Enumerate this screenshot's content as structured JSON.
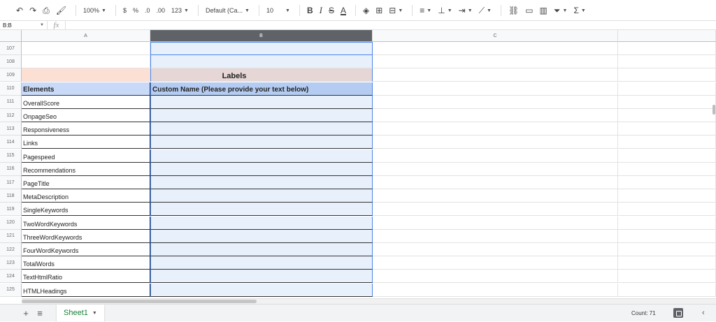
{
  "toolbar": {
    "zoom": "100%",
    "currency": "$",
    "percent": "%",
    "decrease_decimal": ".0",
    "increase_decimal": ".00",
    "more_formats": "123",
    "font_family": "Default (Ca...",
    "font_size": "10",
    "bold": "B",
    "italic": "I",
    "strike": "S",
    "text_color": "A",
    "sum": "Σ"
  },
  "formula_bar": {
    "name_box": "B:B",
    "fx": "fx",
    "content": ""
  },
  "columns": [
    "A",
    "B",
    "C"
  ],
  "selected_column": "B",
  "rows": [
    {
      "num": "107",
      "a": "",
      "b": ""
    },
    {
      "num": "108",
      "a": "",
      "b": ""
    },
    {
      "num": "109",
      "a": "",
      "b": "Labels"
    },
    {
      "num": "110",
      "a": "Elements",
      "b": "Custom Name (Please provide your text below)"
    },
    {
      "num": "111",
      "a": "OverallScore",
      "b": ""
    },
    {
      "num": "112",
      "a": "OnpageSeo",
      "b": ""
    },
    {
      "num": "113",
      "a": "Responsiveness",
      "b": ""
    },
    {
      "num": "114",
      "a": "Links",
      "b": ""
    },
    {
      "num": "115",
      "a": "Pagespeed",
      "b": ""
    },
    {
      "num": "116",
      "a": "Recommendations",
      "b": ""
    },
    {
      "num": "117",
      "a": "PageTitle",
      "b": ""
    },
    {
      "num": "118",
      "a": "MetaDescription",
      "b": ""
    },
    {
      "num": "119",
      "a": "SingleKeywords",
      "b": ""
    },
    {
      "num": "120",
      "a": "TwoWordKeywords",
      "b": ""
    },
    {
      "num": "121",
      "a": "ThreeWordKeywords",
      "b": ""
    },
    {
      "num": "122",
      "a": "FourWordKeywords",
      "b": ""
    },
    {
      "num": "123",
      "a": "TotalWords",
      "b": ""
    },
    {
      "num": "124",
      "a": "TextHtmlRatio",
      "b": ""
    },
    {
      "num": "125",
      "a": "HTMLHeadings",
      "b": ""
    }
  ],
  "sheet_bar": {
    "add_sheet": "+",
    "all_sheets": "≡",
    "active_sheet": "Sheet1",
    "status": "Count: 71"
  },
  "colors": {
    "selected_header": "#5f6368",
    "selection_border": "#4a86e8",
    "selection_fill": "#e8f0fc",
    "peach": "#fde0d4",
    "header_blue": "#c9daf8",
    "sheet_tab_text": "#188038"
  }
}
